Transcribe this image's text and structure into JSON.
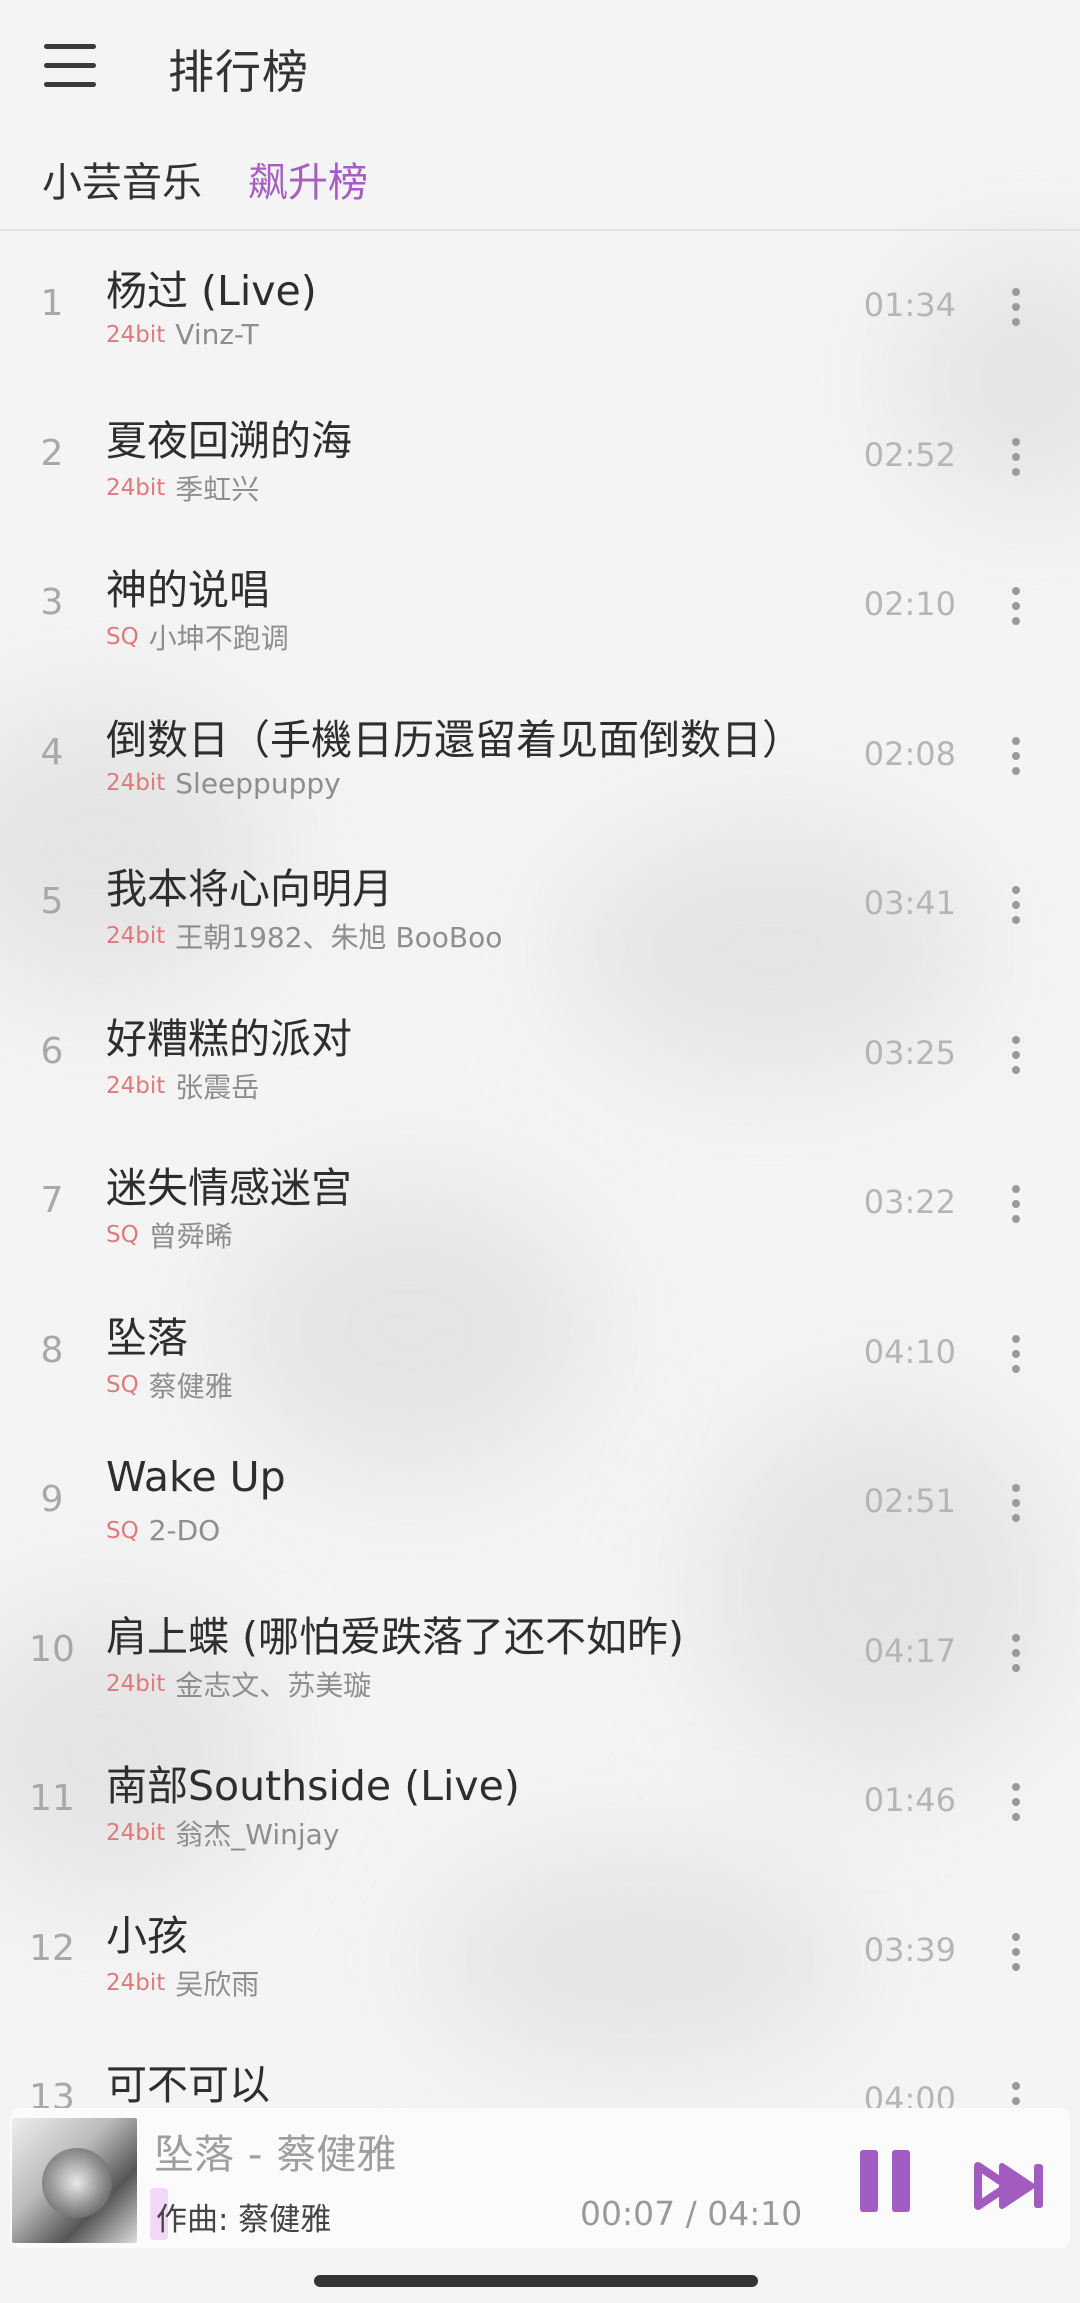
{
  "header": {
    "title": "排行榜"
  },
  "tabs": [
    {
      "label": "小芸音乐"
    },
    {
      "label": "飙升榜"
    }
  ],
  "songs": [
    {
      "rank": "1",
      "title": "杨过 (Live)",
      "quality": "24bit",
      "artist": "Vinz-T",
      "duration": "01:34"
    },
    {
      "rank": "2",
      "title": "夏夜回溯的海",
      "quality": "24bit",
      "artist": "季虹兴",
      "duration": "02:52"
    },
    {
      "rank": "3",
      "title": "神的说唱",
      "quality": "SQ",
      "artist": "小坤不跑调",
      "duration": "02:10"
    },
    {
      "rank": "4",
      "title": "倒数日（手機日历還留着见面倒数日）",
      "quality": "24bit",
      "artist": "Sleeppuppy",
      "duration": "02:08"
    },
    {
      "rank": "5",
      "title": "我本将心向明月",
      "quality": "24bit",
      "artist": "王朝1982、朱旭 BooBoo",
      "duration": "03:41"
    },
    {
      "rank": "6",
      "title": "好糟糕的派对",
      "quality": "24bit",
      "artist": "张震岳",
      "duration": "03:25"
    },
    {
      "rank": "7",
      "title": "迷失情感迷宫",
      "quality": "SQ",
      "artist": "曾舜晞",
      "duration": "03:22"
    },
    {
      "rank": "8",
      "title": "坠落",
      "quality": "SQ",
      "artist": "蔡健雅",
      "duration": "04:10"
    },
    {
      "rank": "9",
      "title": "Wake Up",
      "quality": "SQ",
      "artist": "2-DO",
      "duration": "02:51"
    },
    {
      "rank": "10",
      "title": "肩上蝶 (哪怕爱跌落了还不如昨)",
      "quality": "24bit",
      "artist": "金志文、苏美璇",
      "duration": "04:17"
    },
    {
      "rank": "11",
      "title": "南部Southside (Live)",
      "quality": "24bit",
      "artist": "翁杰_Winjay",
      "duration": "01:46"
    },
    {
      "rank": "12",
      "title": "小孩",
      "quality": "24bit",
      "artist": "吴欣雨",
      "duration": "03:39"
    },
    {
      "rank": "13",
      "title": "可不可以",
      "quality": "",
      "artist": "",
      "duration": "04:00"
    }
  ],
  "player": {
    "song": "坠落",
    "separator": "-",
    "artist": "蔡健雅",
    "lyric": "作曲: 蔡健雅",
    "time": "00:07 / 04:10"
  },
  "colors": {
    "accent": "#a25cc0",
    "quality": "#e07a7a",
    "tab_active": "#a85cc4"
  }
}
